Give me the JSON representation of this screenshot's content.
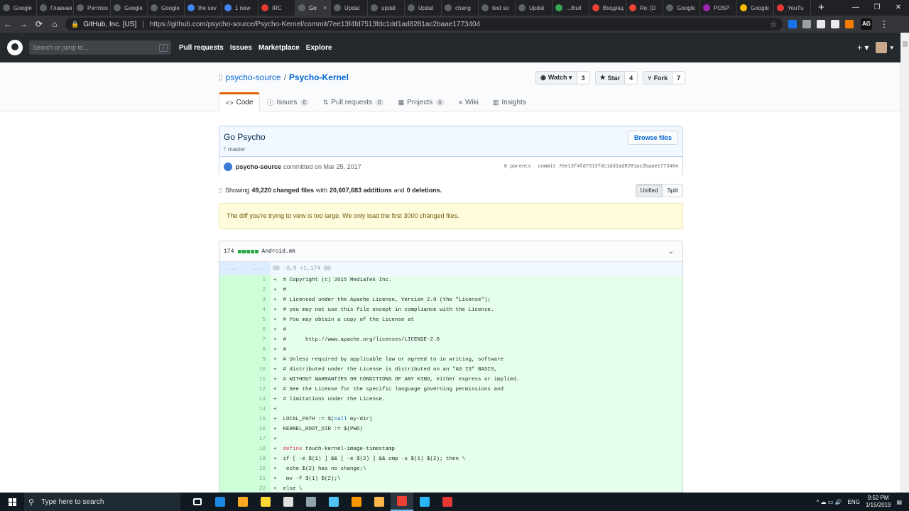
{
  "browser": {
    "tabs": [
      {
        "label": "Google",
        "color": "#5f6368"
      },
      {
        "label": "Главная",
        "color": "#5f6368"
      },
      {
        "label": "Permiss",
        "color": "#5f6368"
      },
      {
        "label": "Google",
        "color": "#5f6368"
      },
      {
        "label": "Google",
        "color": "#5f6368"
      },
      {
        "label": "the sev",
        "color": "#4285f4"
      },
      {
        "label": "1 new",
        "color": "#4285f4"
      },
      {
        "label": "IRC",
        "color": "#e53935"
      },
      {
        "label": "Go",
        "color": "#5f6368",
        "active": true
      },
      {
        "label": "Updat",
        "color": "#5f6368"
      },
      {
        "label": "updat",
        "color": "#5f6368"
      },
      {
        "label": "Updat",
        "color": "#5f6368"
      },
      {
        "label": "chang",
        "color": "#5f6368"
      },
      {
        "label": "test so",
        "color": "#5f6368"
      },
      {
        "label": "Updat",
        "color": "#5f6368"
      },
      {
        "label": ".../buil",
        "color": "#34a853"
      },
      {
        "label": "Входящ",
        "color": "#ea4335"
      },
      {
        "label": "Re: [D",
        "color": "#ea4335"
      },
      {
        "label": "Google",
        "color": "#5f6368"
      },
      {
        "label": "POSP",
        "color": "#9c27b0"
      },
      {
        "label": "Google",
        "color": "#fbbc04"
      },
      {
        "label": "YouTu",
        "color": "#e53935"
      }
    ],
    "new_tab": "+",
    "window_controls": [
      "—",
      "❐",
      "✕"
    ],
    "nav": {
      "back": "←",
      "forward": "→",
      "reload": "⟳",
      "home": "⌂"
    },
    "address": {
      "lock": "🔒",
      "org": "GitHub, Inc. [US]",
      "separator": "|",
      "url": "https://github.com/psycho-source/Psycho-Kernel/commit/7ee13f4fd7513fdc1dd1ad8281ac2baae1773404",
      "star": "☆"
    },
    "extensions": [
      "#1a73e8",
      "#9aa0a6",
      "#e8eaed",
      "#e8eaed",
      "#f57c00"
    ],
    "profile": "AG",
    "menu": "⋮"
  },
  "gh": {
    "search_placeholder": "Search or jump to...",
    "search_key": "/",
    "nav": [
      "Pull requests",
      "Issues",
      "Marketplace",
      "Explore"
    ],
    "plus": "+ ▾",
    "avatar_caret": "▾"
  },
  "repo": {
    "owner": "psycho-source",
    "slash": "/",
    "name": "Psycho-Kernel",
    "watch_label": "Watch ▾",
    "watch_count": "3",
    "star_label": "Star",
    "star_count": "4",
    "fork_label": "Fork",
    "fork_count": "7",
    "tabs": [
      {
        "icon": "<>",
        "label": "Code",
        "count": ""
      },
      {
        "icon": "ⓘ",
        "label": "Issues",
        "count": "0"
      },
      {
        "icon": "⇅",
        "label": "Pull requests",
        "count": "0"
      },
      {
        "icon": "▦",
        "label": "Projects",
        "count": "0"
      },
      {
        "icon": "≡",
        "label": "Wiki",
        "count": ""
      },
      {
        "icon": "▥",
        "label": "Insights",
        "count": ""
      }
    ]
  },
  "commit": {
    "title": "Go Psycho",
    "branch": "master",
    "browse": "Browse files",
    "author": "psycho-source",
    "committed": "committed on Mar 25, 2017",
    "parents": "0 parents",
    "sha_label": "commit",
    "sha": "7ee13f4fd7513fdc1dd1ad8281ac2baae1773404"
  },
  "toc": {
    "showing": "Showing",
    "changed": "49,220 changed files",
    "with": "with",
    "additions": "20,607,683 additions",
    "and": "and",
    "deletions": "0 deletions.",
    "unified": "Unified",
    "split": "Split"
  },
  "flash": "The diff you're trying to view is too large. We only load the first 3000 changed files.",
  "file": {
    "count": "174",
    "name": "Android.mk",
    "chevron": "⌄",
    "hunk_l": "...",
    "hunk_r": "...",
    "hunk": "@@ -0,0 +1,174 @@",
    "lines": [
      {
        "n": "1",
        "code": "+  # Copyright (c) 2015 MediaTek Inc."
      },
      {
        "n": "2",
        "code": "+  #"
      },
      {
        "n": "3",
        "code": "+  # Licensed under the Apache License, Version 2.0 (the \"License\");"
      },
      {
        "n": "4",
        "code": "+  # you may not use this file except in compliance with the License."
      },
      {
        "n": "5",
        "code": "+  # You may obtain a copy of the License at"
      },
      {
        "n": "6",
        "code": "+  #"
      },
      {
        "n": "7",
        "code": "+  #      http://www.apache.org/licenses/LICENSE-2.0"
      },
      {
        "n": "8",
        "code": "+  #"
      },
      {
        "n": "9",
        "code": "+  # Unless required by applicable law or agreed to in writing, software"
      },
      {
        "n": "10",
        "code": "+  # distributed under the License is distributed on an \"AS IS\" BASIS,"
      },
      {
        "n": "11",
        "code": "+  # WITHOUT WARRANTIES OR CONDITIONS OF ANY KIND, either express or implied."
      },
      {
        "n": "12",
        "code": "+  # See the License for the specific language governing permissions and"
      },
      {
        "n": "13",
        "code": "+  # limitations under the License."
      },
      {
        "n": "14",
        "code": "+"
      },
      {
        "n": "15",
        "code": "+  LOCAL_PATH := $(call my-dir)"
      },
      {
        "n": "16",
        "code": "+  KERNEL_ROOT_DIR := $(PWD)"
      },
      {
        "n": "17",
        "code": "+"
      },
      {
        "n": "18",
        "code": "+  define touch-kernel-image-timestamp"
      },
      {
        "n": "19",
        "code": "+  if [ -e $(1) ] && [ -e $(2) ] && cmp -s $(1) $(2); then \\"
      },
      {
        "n": "20",
        "code": "+   echo $(2) has no change;\\"
      },
      {
        "n": "21",
        "code": "+   mv -f $(1) $(2);\\"
      },
      {
        "n": "22",
        "code": "+  else \\"
      }
    ]
  },
  "taskbar": {
    "search": "Type here to search",
    "apps": [
      {
        "name": "task-view",
        "color": "#ffffff",
        "on": false
      },
      {
        "name": "edge",
        "color": "#1e88e5",
        "on": false
      },
      {
        "name": "explorer",
        "color": "#f9a825",
        "on": false
      },
      {
        "name": "store",
        "color": "#fdd835",
        "on": false
      },
      {
        "name": "mail",
        "color": "#e0e0e0",
        "on": false
      },
      {
        "name": "steam",
        "color": "#90a4ae",
        "on": false
      },
      {
        "name": "app-blue",
        "color": "#4fc3f7",
        "on": false
      },
      {
        "name": "vlc",
        "color": "#ff9800",
        "on": false
      },
      {
        "name": "git",
        "color": "#ffb74d",
        "on": false
      },
      {
        "name": "chrome",
        "color": "#ea4335",
        "on": true
      },
      {
        "name": "telegram",
        "color": "#29b6f6",
        "on": false
      },
      {
        "name": "recorder",
        "color": "#e53935",
        "on": false
      }
    ],
    "tray": "^  ☁  ▭  🔊",
    "lang": "ENG",
    "time": "9:52 PM",
    "date": "1/15/2019",
    "notif": "▤"
  }
}
